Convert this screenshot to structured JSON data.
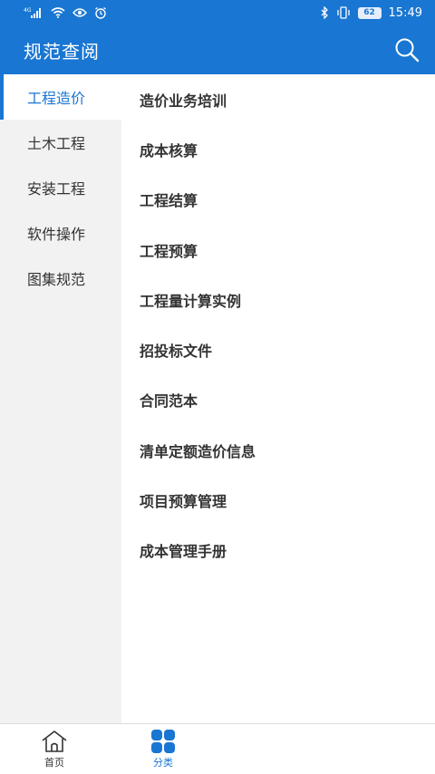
{
  "status_bar": {
    "network": "4G",
    "battery": "62",
    "time": "15:49"
  },
  "app_bar": {
    "title": "规范查阅",
    "search_icon": "search-icon"
  },
  "sidebar": {
    "items": [
      {
        "label": "工程造价",
        "active": true
      },
      {
        "label": "土木工程",
        "active": false
      },
      {
        "label": "安装工程",
        "active": false
      },
      {
        "label": "软件操作",
        "active": false
      },
      {
        "label": "图集规范",
        "active": false
      }
    ]
  },
  "content": {
    "items": [
      {
        "label": "造价业务培训"
      },
      {
        "label": "成本核算"
      },
      {
        "label": "工程结算"
      },
      {
        "label": "工程预算"
      },
      {
        "label": "工程量计算实例"
      },
      {
        "label": "招投标文件"
      },
      {
        "label": "合同范本"
      },
      {
        "label": "清单定额造价信息"
      },
      {
        "label": "项目预算管理"
      },
      {
        "label": "成本管理手册"
      }
    ]
  },
  "bottom_nav": {
    "items": [
      {
        "label": "首页",
        "icon": "home-icon",
        "active": false
      },
      {
        "label": "分类",
        "icon": "grid-icon",
        "active": true
      }
    ]
  },
  "colors": {
    "primary": "#1976d2",
    "sidebar_bg": "#f2f2f2",
    "text": "#333333"
  }
}
